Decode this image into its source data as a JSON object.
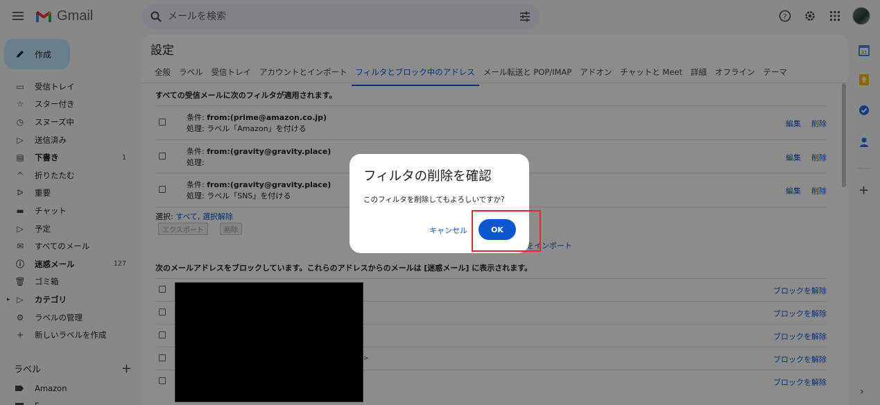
{
  "header": {
    "app_name": "Gmail",
    "search_placeholder": "メールを検索"
  },
  "sidebar": {
    "compose_label": "作成",
    "items": [
      {
        "label": "受信トレイ",
        "icon": "inbox-icon",
        "count": ""
      },
      {
        "label": "スター付き",
        "icon": "star-icon",
        "count": ""
      },
      {
        "label": "スヌーズ中",
        "icon": "clock-icon",
        "count": ""
      },
      {
        "label": "送信済み",
        "icon": "send-icon",
        "count": ""
      },
      {
        "label": "下書き",
        "icon": "draft-icon",
        "count": "1",
        "bold": true
      },
      {
        "label": "折りたたむ",
        "icon": "chevron-up-icon",
        "count": ""
      },
      {
        "label": "重要",
        "icon": "important-icon",
        "count": ""
      },
      {
        "label": "チャット",
        "icon": "chat-icon",
        "count": ""
      },
      {
        "label": "予定",
        "icon": "scheduled-icon",
        "count": ""
      },
      {
        "label": "すべてのメール",
        "icon": "all-mail-icon",
        "count": ""
      },
      {
        "label": "迷惑メール",
        "icon": "spam-icon",
        "count": "127",
        "bold": true
      },
      {
        "label": "ゴミ箱",
        "icon": "trash-icon",
        "count": ""
      },
      {
        "label": "カテゴリ",
        "icon": "label-outline-icon",
        "count": "",
        "bold": true
      },
      {
        "label": "ラベルの管理",
        "icon": "gear-icon",
        "count": ""
      },
      {
        "label": "新しいラベルを作成",
        "icon": "plus-icon",
        "count": ""
      }
    ],
    "labels_header": "ラベル",
    "labels": [
      "Amazon",
      "F"
    ]
  },
  "settings": {
    "title": "設定",
    "tabs": [
      "全般",
      "ラベル",
      "受信トレイ",
      "アカウントとインポート",
      "フィルタとブロック中のアドレス",
      "メール転送と POP/IMAP",
      "アドオン",
      "チャットと Meet",
      "詳細",
      "オフライン",
      "テーマ"
    ],
    "active_tab_index": 4,
    "filters_header": "すべての受信メールに次のフィルタが適用されます。",
    "filters": [
      {
        "condition_label": "条件:",
        "condition": "from:(prime@amazon.co.jp)",
        "action_label": "処理:",
        "action": "ラベル「Amazon」を付ける"
      },
      {
        "condition_label": "条件:",
        "condition": "from:(gravity@gravity.place)",
        "action_label": "処理:",
        "action": ""
      },
      {
        "condition_label": "条件:",
        "condition": "from:(gravity@gravity.place)",
        "action_label": "処理:",
        "action": "ラベル「SNS」を付ける"
      }
    ],
    "edit_label": "編集",
    "delete_label": "削除",
    "select_prefix": "選択:",
    "select_all": "すべて",
    "select_none": "選択解除",
    "export_button": "エクスポート",
    "delete_button": "削除",
    "import_link": "をインポート",
    "blocked_header": "次のメールアドレスをブロックしています。これらのアドレスからのメールは [迷惑メール] に表示されます。",
    "unblock_label": "ブロックを解除",
    "blocked_count": 5,
    "stray_glyph": ">"
  },
  "dialog": {
    "title": "フィルタの削除を確認",
    "message": "このフィルタを削除してもよろしいですか?",
    "cancel": "キャンセル",
    "ok": "OK"
  },
  "colors": {
    "accent": "#0b57d0",
    "compose_bg": "#c2e7ff",
    "highlight": "#e3262f"
  }
}
